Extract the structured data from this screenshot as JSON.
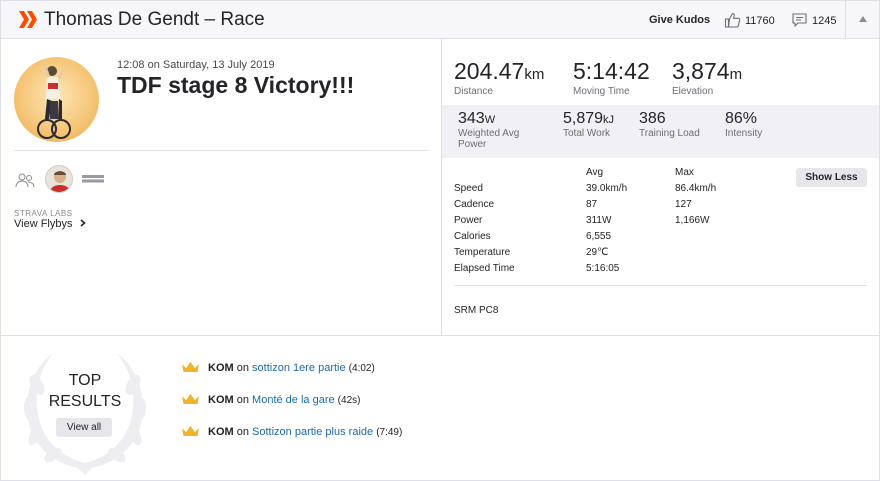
{
  "header": {
    "title": "Thomas De Gendt – Race",
    "give_kudos": "Give Kudos",
    "kudos_count": "11760",
    "comment_count": "1245"
  },
  "activity": {
    "date": "12:08 on Saturday, 13 July 2019",
    "title": "TDF stage 8 Victory!!!",
    "labs_label": "STRAVA LABS",
    "flybys_label": "View Flybys"
  },
  "primary_stats": [
    {
      "value": "204.47",
      "unit": "km",
      "label": "Distance"
    },
    {
      "value": "5:14:42",
      "unit": "",
      "label": "Moving Time"
    },
    {
      "value": "3,874",
      "unit": "m",
      "label": "Elevation"
    }
  ],
  "secondary_stats": [
    {
      "value": "343",
      "unit": "W",
      "label_line1": "Weighted Avg",
      "label_line2": "Power"
    },
    {
      "value": "5,879",
      "unit": "kJ",
      "label_line1": "Total Work",
      "label_line2": ""
    },
    {
      "value": "386",
      "unit": "",
      "label_line1": "Training Load",
      "label_line2": ""
    },
    {
      "value": "86%",
      "unit": "",
      "label_line1": "Intensity",
      "label_line2": ""
    }
  ],
  "details": {
    "avg_header": "Avg",
    "max_header": "Max",
    "show_less": "Show Less",
    "rows": [
      {
        "label": "Speed",
        "avg": "39.0km/h",
        "max": "86.4km/h"
      },
      {
        "label": "Cadence",
        "avg": "87",
        "max": "127"
      },
      {
        "label": "Power",
        "avg": "311W",
        "max": "1,166W"
      },
      {
        "label": "Calories",
        "avg": "6,555",
        "max": ""
      },
      {
        "label": "Temperature",
        "avg": "29℃",
        "max": ""
      },
      {
        "label": "Elapsed Time",
        "avg": "5:16:05",
        "max": ""
      }
    ],
    "device": "SRM PC8"
  },
  "top_results": {
    "title_line1": "TOP",
    "title_line2": "RESULTS",
    "view_all": "View all",
    "items": [
      {
        "badge": "KOM",
        "on": "on",
        "segment": "sottizon 1ere partie",
        "time": "(4:02)"
      },
      {
        "badge": "KOM",
        "on": "on",
        "segment": "Monté de la gare",
        "time": "(42s)"
      },
      {
        "badge": "KOM",
        "on": "on",
        "segment": "Sottizon partie plus raide",
        "time": "(7:49)"
      }
    ]
  },
  "colors": {
    "brand": "#fc4c02",
    "link": "#1e6aa8",
    "crown": "#f0b429"
  }
}
